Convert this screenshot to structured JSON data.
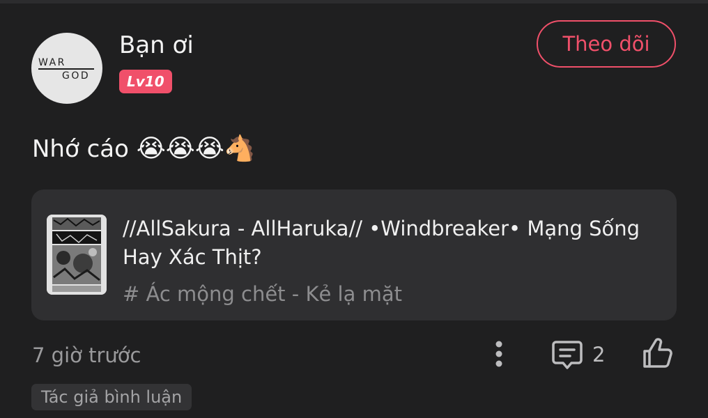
{
  "post": {
    "author": {
      "name": "Bạn ơi",
      "level": "Lv10",
      "avatar_logo_text": "WAR GOD"
    },
    "follow_label": "Theo dõi",
    "text": "Nhớ cáo",
    "emojis": "😭😭😭🐴",
    "story": {
      "title": "//AllSakura - AllHaruka// •Windbreaker• Mạng Sống Hay Xác Thịt?",
      "chapter": "# Ác mộng chết - Kẻ lạ mặt"
    },
    "time": "7 giờ trước",
    "comment_count": "2",
    "author_comment_tag": "Tác giả bình luận"
  },
  "icons": {
    "more": "more-vertical-icon",
    "comment": "comment-icon",
    "like": "thumbs-up-icon"
  },
  "colors": {
    "background": "#1f1f20",
    "card": "#2f2f31",
    "accent": "#f0506a",
    "muted_text": "#9a9a9c"
  }
}
